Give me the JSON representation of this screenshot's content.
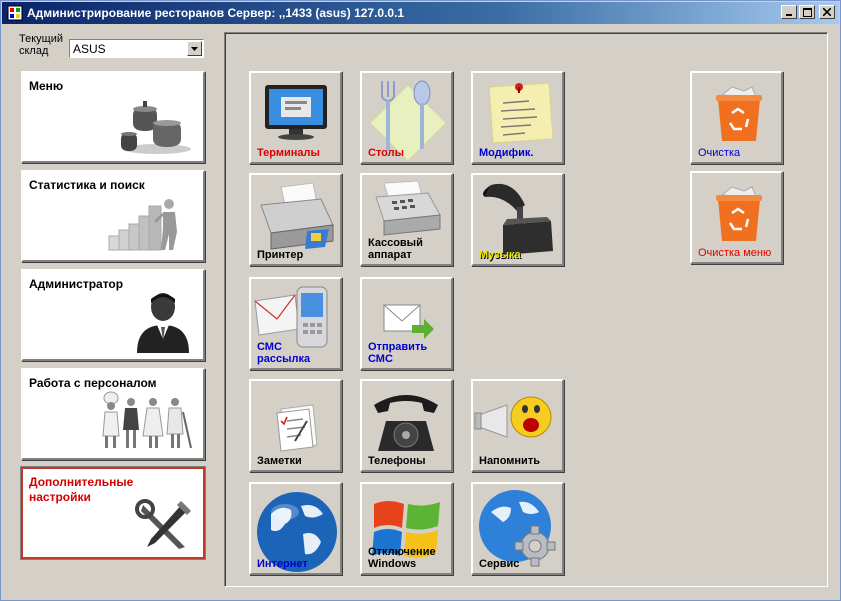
{
  "window": {
    "title": "Администрирование ресторанов  Сервер: ,,1433 (asus) 127.0.0.1"
  },
  "warehouse": {
    "label": "Текущий склад",
    "value": "ASUS"
  },
  "nav": [
    {
      "label": "Меню",
      "icon": "pots-icon"
    },
    {
      "label": "Статистика и поиск",
      "icon": "statistics-icon"
    },
    {
      "label": "Администратор",
      "icon": "admin-icon"
    },
    {
      "label": "Работа с персоналом",
      "icon": "staff-icon"
    },
    {
      "label": "Дополнительные настройки",
      "icon": "tools-icon"
    }
  ],
  "tiles": {
    "terminals": "Терминалы",
    "tables": "Столы",
    "modifiers": "Модифик.",
    "cleanup": "Очистка",
    "cleanup_menu": "Очистка меню",
    "printer": "Принтер",
    "cash_register": "Кассовый аппарат",
    "music": "Музыка",
    "sms_mailing": "СМС рассылка",
    "send_sms": "Отправить СМС",
    "notes": "Заметки",
    "phones": "Телефоны",
    "remind": "Напомнить",
    "internet": "Интернет",
    "shutdown_windows": "Отключение Windows",
    "service": "Сервис"
  },
  "colors": {
    "title_start": "#0a246a",
    "title_end": "#a6caf0",
    "label_red": "#e00000",
    "label_blue": "#0000d0",
    "label_yellow": "#e8e800",
    "active_border": "#c0392b",
    "recycle_orange": "#f07020"
  }
}
